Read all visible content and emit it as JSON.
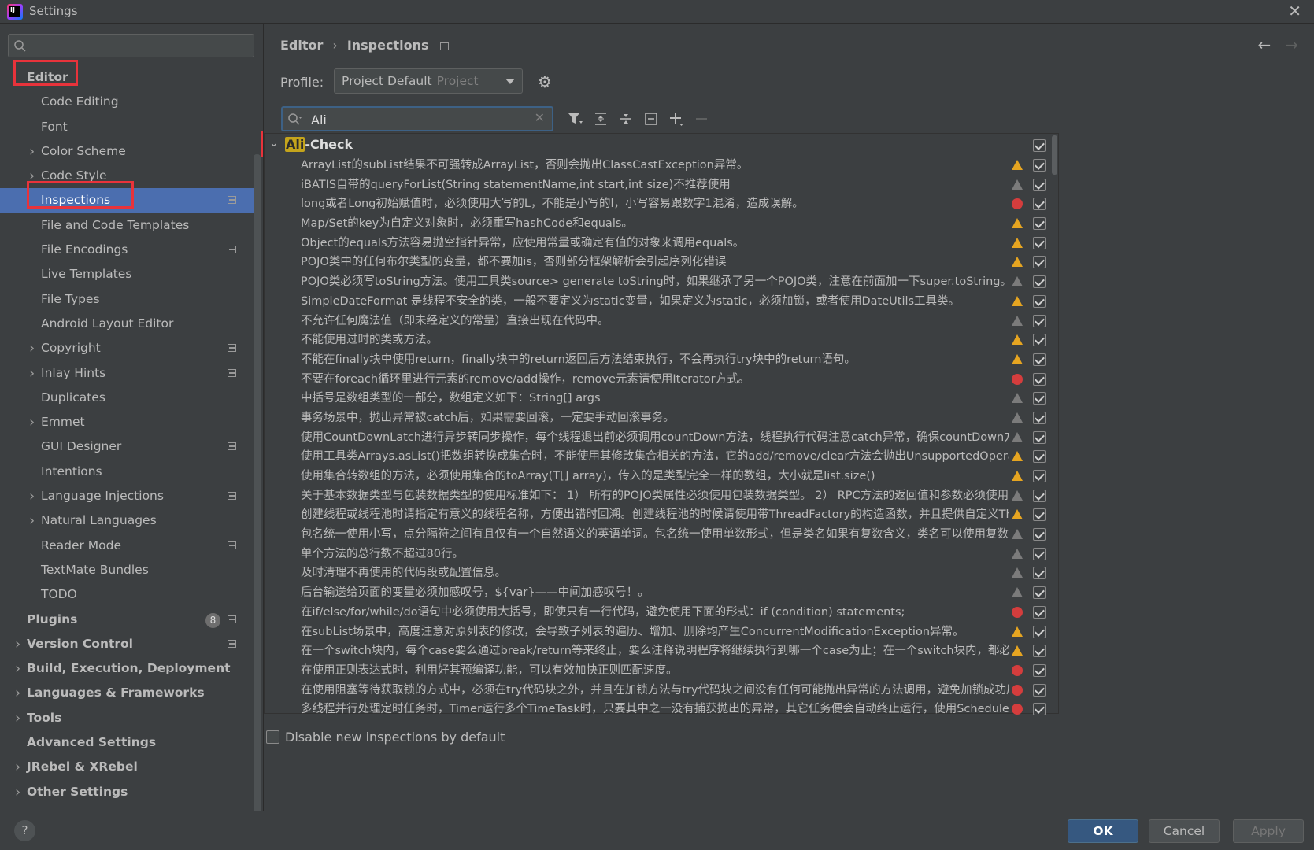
{
  "window": {
    "title": "Settings"
  },
  "sidebar": {
    "search_placeholder": "",
    "items": [
      {
        "label": "Editor",
        "level": 0,
        "bold": true,
        "chevron": false,
        "proj": false
      },
      {
        "label": "Code Editing",
        "level": 1,
        "chevron": false,
        "proj": false
      },
      {
        "label": "Font",
        "level": 1,
        "chevron": false,
        "proj": false
      },
      {
        "label": "Color Scheme",
        "level": 1,
        "chevron": true,
        "proj": false
      },
      {
        "label": "Code Style",
        "level": 1,
        "chevron": true,
        "proj": false
      },
      {
        "label": "Inspections",
        "level": 1,
        "chevron": false,
        "proj": true,
        "selected": true
      },
      {
        "label": "File and Code Templates",
        "level": 1,
        "chevron": false,
        "proj": false
      },
      {
        "label": "File Encodings",
        "level": 1,
        "chevron": false,
        "proj": true
      },
      {
        "label": "Live Templates",
        "level": 1,
        "chevron": false,
        "proj": false
      },
      {
        "label": "File Types",
        "level": 1,
        "chevron": false,
        "proj": false
      },
      {
        "label": "Android Layout Editor",
        "level": 1,
        "chevron": false,
        "proj": false
      },
      {
        "label": "Copyright",
        "level": 1,
        "chevron": true,
        "proj": true
      },
      {
        "label": "Inlay Hints",
        "level": 1,
        "chevron": true,
        "proj": true
      },
      {
        "label": "Duplicates",
        "level": 1,
        "chevron": false,
        "proj": false
      },
      {
        "label": "Emmet",
        "level": 1,
        "chevron": true,
        "proj": false
      },
      {
        "label": "GUI Designer",
        "level": 1,
        "chevron": false,
        "proj": true
      },
      {
        "label": "Intentions",
        "level": 1,
        "chevron": false,
        "proj": false
      },
      {
        "label": "Language Injections",
        "level": 1,
        "chevron": true,
        "proj": true
      },
      {
        "label": "Natural Languages",
        "level": 1,
        "chevron": true,
        "proj": false
      },
      {
        "label": "Reader Mode",
        "level": 1,
        "chevron": false,
        "proj": true
      },
      {
        "label": "TextMate Bundles",
        "level": 1,
        "chevron": false,
        "proj": false
      },
      {
        "label": "TODO",
        "level": 1,
        "chevron": false,
        "proj": false
      },
      {
        "label": "Plugins",
        "level": 0,
        "bold": true,
        "chevron": false,
        "proj": true,
        "badge": "8"
      },
      {
        "label": "Version Control",
        "level": 0,
        "bold": true,
        "chevron": true,
        "proj": true
      },
      {
        "label": "Build, Execution, Deployment",
        "level": 0,
        "bold": true,
        "chevron": true,
        "proj": false
      },
      {
        "label": "Languages & Frameworks",
        "level": 0,
        "bold": true,
        "chevron": true,
        "proj": false
      },
      {
        "label": "Tools",
        "level": 0,
        "bold": true,
        "chevron": true,
        "proj": false
      },
      {
        "label": "Advanced Settings",
        "level": 0,
        "bold": true,
        "chevron": false,
        "proj": false
      },
      {
        "label": "JRebel & XRebel",
        "level": 0,
        "bold": true,
        "chevron": true,
        "proj": false
      },
      {
        "label": "Other Settings",
        "level": 0,
        "bold": true,
        "chevron": true,
        "proj": false
      }
    ]
  },
  "main": {
    "breadcrumb": [
      "Editor",
      "Inspections"
    ],
    "profile_label": "Profile:",
    "profile_value": "Project Default",
    "profile_sub": "Project",
    "search_value": "Ali",
    "group": {
      "name_highlight": "Ali",
      "name_rest": "-Check"
    },
    "inspections": [
      {
        "text": "ArrayList的subList结果不可强转成ArrayList，否则会抛出ClassCastException异常。",
        "severity": "warn"
      },
      {
        "text": "iBATIS自带的queryForList(String statementName,int start,int size)不推荐使用",
        "severity": "weak"
      },
      {
        "text": "long或者Long初始赋值时，必须使用大写的L，不能是小写的l，小写容易跟数字1混淆，造成误解。",
        "severity": "err"
      },
      {
        "text": "Map/Set的key为自定义对象时，必须重写hashCode和equals。",
        "severity": "warn"
      },
      {
        "text": "Object的equals方法容易抛空指针异常，应使用常量或确定有值的对象来调用equals。",
        "severity": "warn"
      },
      {
        "text": "POJO类中的任何布尔类型的变量，都不要加is，否则部分框架解析会引起序列化错误",
        "severity": "warn"
      },
      {
        "text": "POJO类必须写toString方法。使用工具类source> generate toString时，如果继承了另一个POJO类，注意在前面加一下super.toString。",
        "severity": "weak"
      },
      {
        "text": "SimpleDateFormat 是线程不安全的类，一般不要定义为static变量，如果定义为static，必须加锁，或者使用DateUtils工具类。",
        "severity": "warn"
      },
      {
        "text": "不允许任何魔法值（即未经定义的常量）直接出现在代码中。",
        "severity": "weak"
      },
      {
        "text": "不能使用过时的类或方法。",
        "severity": "warn"
      },
      {
        "text": "不能在finally块中使用return，finally块中的return返回后方法结束执行，不会再执行try块中的return语句。",
        "severity": "warn"
      },
      {
        "text": "不要在foreach循环里进行元素的remove/add操作，remove元素请使用Iterator方式。",
        "severity": "err"
      },
      {
        "text": "中括号是数组类型的一部分，数组定义如下：String[] args",
        "severity": "weak"
      },
      {
        "text": "事务场景中，抛出异常被catch后，如果需要回滚，一定要手动回滚事务。",
        "severity": "weak"
      },
      {
        "text": "使用CountDownLatch进行异步转同步操作，每个线程退出前必须调用countDown方法，线程执行代码注意catch异常，确保countDown方法可以执行",
        "severity": "weak"
      },
      {
        "text": "使用工具类Arrays.asList()把数组转换成集合时，不能使用其修改集合相关的方法，它的add/remove/clear方法会抛出UnsupportedOperationException异常",
        "severity": "warn"
      },
      {
        "text": "使用集合转数组的方法，必须使用集合的toArray(T[] array)，传入的是类型完全一样的数组，大小就是list.size()",
        "severity": "warn"
      },
      {
        "text": "关于基本数据类型与包装数据类型的使用标准如下：   1） 所有的POJO类属性必须使用包装数据类型。   2） RPC方法的返回值和参数必须使用包装数据类型",
        "severity": "weak"
      },
      {
        "text": "创建线程或线程池时请指定有意义的线程名称，方便出错时回溯。创建线程池的时候请使用带ThreadFactory的构造函数，并且提供自定义ThreadFactory实现",
        "severity": "warn"
      },
      {
        "text": "包名统一使用小写，点分隔符之间有且仅有一个自然语义的英语单词。包名统一使用单数形式，但是类名如果有复数含义，类名可以使用复数形式",
        "severity": "weak"
      },
      {
        "text": "单个方法的总行数不超过80行。",
        "severity": "weak"
      },
      {
        "text": "及时清理不再使用的代码段或配置信息。",
        "severity": "weak"
      },
      {
        "text": "后台输送给页面的变量必须加感叹号，${var}——中间加感叹号！。",
        "severity": "weak"
      },
      {
        "text": "在if/else/for/while/do语句中必须使用大括号，即使只有一行代码，避免使用下面的形式：if (condition) statements;",
        "severity": "err"
      },
      {
        "text": "在subList场景中，高度注意对原列表的修改，会导致子列表的遍历、增加、删除均产生ConcurrentModificationException异常。",
        "severity": "warn"
      },
      {
        "text": "在一个switch块内，每个case要么通过break/return等来终止，要么注释说明程序将继续执行到哪一个case为止；在一个switch块内，都必须包含一个default语句",
        "severity": "warn"
      },
      {
        "text": "在使用正则表达式时，利用好其预编译功能，可以有效加快正则匹配速度。",
        "severity": "err"
      },
      {
        "text": "在使用阻塞等待获取锁的方式中，必须在try代码块之外，并且在加锁方法与try代码块之间没有任何可能抛出异常的方法调用，避免加锁成功后，在finally中无法解锁",
        "severity": "err"
      },
      {
        "text": "多线程并行处理定时任务时，Timer运行多个TimeTask时，只要其中之一没有捕获抛出的异常，其它任务便会自动终止运行，使用ScheduledExecutorService则没有这个问题",
        "severity": "err"
      }
    ],
    "disable_new_label": "Disable new inspections by default"
  },
  "footer": {
    "ok": "OK",
    "cancel": "Cancel",
    "apply": "Apply",
    "help": "?"
  },
  "colors": {
    "accent": "#4b6eaf",
    "highlight_box": "#e8333b",
    "warning": "#e6a521",
    "error": "#d43d3d"
  }
}
